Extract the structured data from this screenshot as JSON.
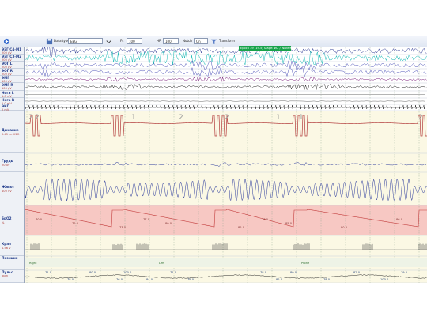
{
  "toolbar": {
    "data_label": "Data type",
    "data_value": "EEG",
    "field1_label": "Fs",
    "field1_value": "100",
    "field2_label": "HP",
    "field2_value": "100",
    "field3_label": "Notch",
    "field3_value": "On",
    "field4_label": "Transform"
  },
  "banner": "Epoch 39 (19.5) Stage: W2 / Wake/N1",
  "channels": [
    {
      "name": "ЭЭГ C4-M1",
      "scale": "200 µV"
    },
    {
      "name": "ЭЭГ C3-M2",
      "scale": "200 µV"
    },
    {
      "name": "ЭОГ L",
      "scale": "200 µV"
    },
    {
      "name": "ЭОГ R",
      "scale": "200 µV"
    },
    {
      "name": "ЭМГ",
      "scale": "100 µV"
    },
    {
      "name": "ЭМГ R",
      "scale": "100 µV"
    },
    {
      "name": "Нога L",
      "scale": "1.0 mV"
    },
    {
      "name": "Нога R",
      "scale": "1.0 mV"
    },
    {
      "name": "ЭКГ",
      "scale": "2 mV"
    },
    {
      "name": "Дыхание",
      "scale": "0.45 cmH2O"
    },
    {
      "name": "Грудь",
      "scale": "20 uV"
    },
    {
      "name": "Живот",
      "scale": "400 uV"
    },
    {
      "name": "SpO2",
      "scale": "%"
    },
    {
      "name": "Храп",
      "scale": "1.56 V"
    },
    {
      "name": "Позиция",
      "scale": ""
    },
    {
      "name": "Пульс",
      "scale": "bpm"
    }
  ],
  "flow_labels": [
    "2",
    "2",
    "1",
    "2",
    "2",
    "1",
    "1",
    "2"
  ],
  "spo2_labels": [
    "70.0",
    "72.0",
    "73.0",
    "77.0",
    "80.0",
    "82.0",
    "78.0",
    "85.0",
    "80.0",
    "86.0"
  ],
  "position_labels": [
    "Right",
    "Left",
    "Prone"
  ],
  "pulse_labels": [
    "71.0",
    "78.0",
    "80.0",
    "76.0",
    "100.0",
    "84.0",
    "71.0",
    "79.0",
    "78.0",
    "82.0",
    "80.0",
    "78.0",
    "82.0",
    "100.0",
    "79.0"
  ],
  "colors": {
    "eeg1": "#1d2a8c",
    "eeg2": "#14b8b4",
    "eog": "#3a3fb0",
    "emg": "#7a1f7a",
    "ecg": "#111111",
    "flow": "#b23b3b",
    "effort": "#2b3a9c",
    "spo2_band": "#f5b8b8",
    "resp_bg": "#fbf8e4"
  }
}
